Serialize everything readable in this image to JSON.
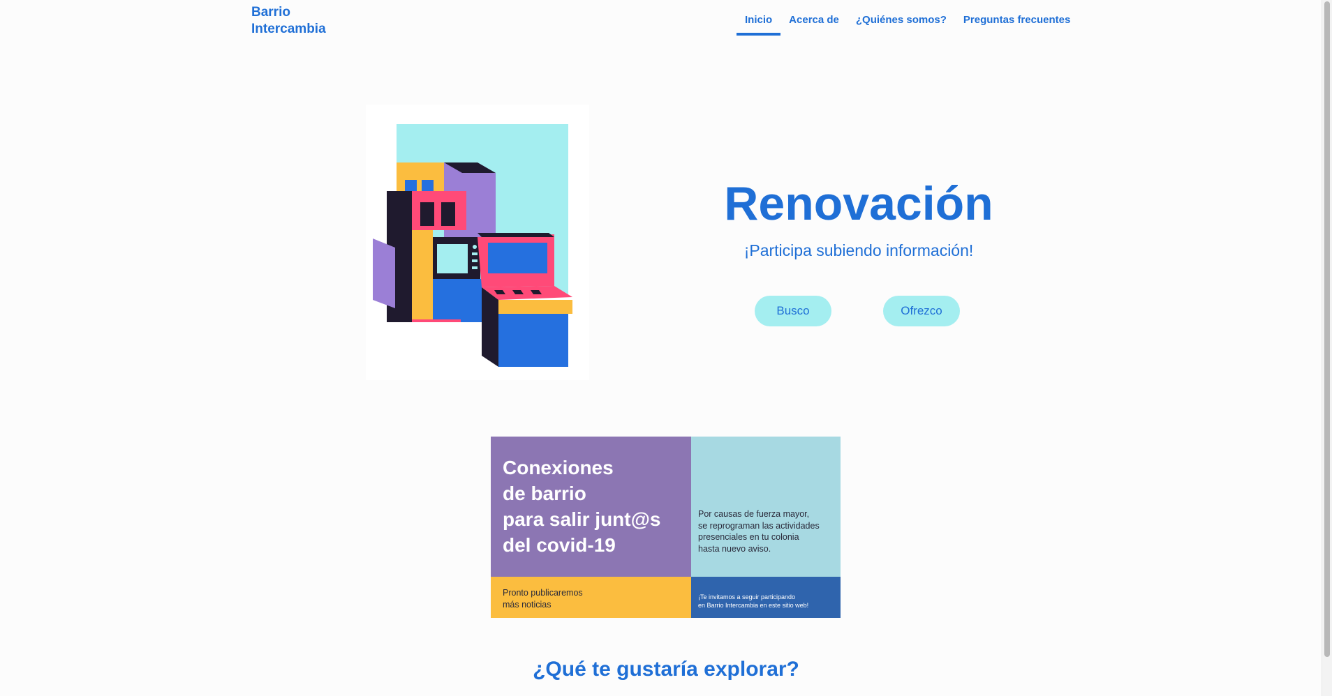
{
  "header": {
    "brand_line1": "Barrio",
    "brand_line2": "Intercambia",
    "nav": [
      {
        "label": "Inicio",
        "active": true
      },
      {
        "label": "Acerca de",
        "active": false
      },
      {
        "label": "¿Quiénes somos?",
        "active": false
      },
      {
        "label": "Preguntas frecuentes",
        "active": false
      }
    ]
  },
  "hero": {
    "title": "Renovación",
    "subtitle": "¡Participa subiendo información!",
    "buttons": {
      "busco": "Busco",
      "ofrezco": "Ofrezco"
    },
    "illustration": "isometric-buildings-illustration"
  },
  "banner": {
    "headline": [
      "Conexiones",
      "de barrio",
      "para salir junt@s",
      "del covid-19"
    ],
    "notice": [
      "Por causas de fuerza mayor,",
      "se reprograman las actividades",
      "presenciales en tu colonia",
      "hasta nuevo aviso."
    ],
    "soon": [
      "Pronto publicaremos",
      "más noticias"
    ],
    "invite": [
      "¡Te invitamos a seguir participando",
      "en Barrio Intercambia en este sitio web!"
    ]
  },
  "explore": {
    "title": "¿Qué te gustaría explorar?"
  },
  "colors": {
    "accent": "#1f6fd6",
    "pill": "#a4eef0",
    "banner_purple": "#8c76b3",
    "banner_cyan": "#a7d9e2",
    "banner_yellow": "#fbbd3f",
    "banner_blue": "#2f64ad"
  }
}
